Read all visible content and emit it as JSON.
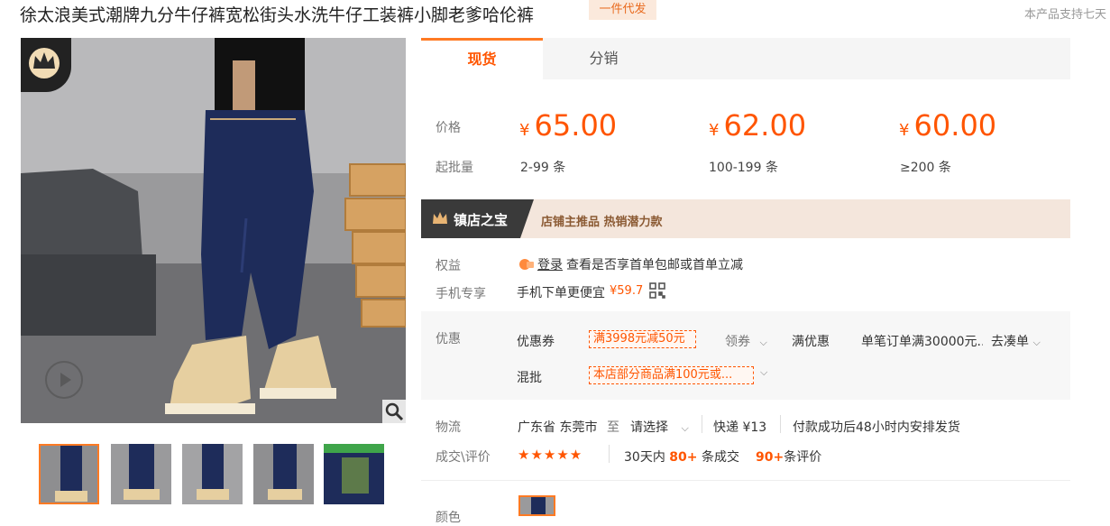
{
  "product": {
    "title": "徐太浪美式潮牌九分牛仔裤宽松街头水洗牛仔工装裤小脚老爹哈伦裤",
    "badge": "一件代发",
    "support_text": "本产品支持七天"
  },
  "tabs": [
    "现货",
    "分销"
  ],
  "pricing": {
    "price_label": "价格",
    "moq_label": "起批量",
    "currency": "¥",
    "tiers": [
      {
        "price": "65.00",
        "range": "2-99 条"
      },
      {
        "price": "62.00",
        "range": "100-199 条"
      },
      {
        "price": "60.00",
        "range": "≥200 条"
      }
    ]
  },
  "shop_banner": {
    "tag": "镇店之宝",
    "desc": "店铺主推品   热销潜力款"
  },
  "benefits": {
    "label": "权益",
    "login": "登录",
    "text": "查看是否享首单包邮或首单立减",
    "mobile_label": "手机专享",
    "mobile_text": "手机下单更便宜",
    "mobile_price": "¥59.7"
  },
  "discounts": {
    "label": "优惠",
    "coupon_label": "优惠券",
    "coupon_value": "满3998元减50元",
    "get_coupon": "领券",
    "full_discount_label": "满优惠",
    "full_discount_text": "单笔订单满30000元...",
    "go_bundle": "去凑单",
    "mixed_label": "混批",
    "mixed_value": "本店部分商品满100元或..."
  },
  "logistics": {
    "label": "物流",
    "origin": "广东省 东莞市",
    "to": "至",
    "select": "请选择",
    "express": "快递 ¥13",
    "note": "付款成功后48小时内安排发货"
  },
  "deals": {
    "label": "成交\\评价",
    "stars": "★★★★★",
    "period": "30天内",
    "count": "80+",
    "count_unit": "条成交",
    "reviews": "90+",
    "reviews_unit": "条评价"
  },
  "color_label": "颜色",
  "colors": {
    "accent": "#ff5500",
    "tab_border": "#ff7a23",
    "banner": "#f4e6dc"
  }
}
